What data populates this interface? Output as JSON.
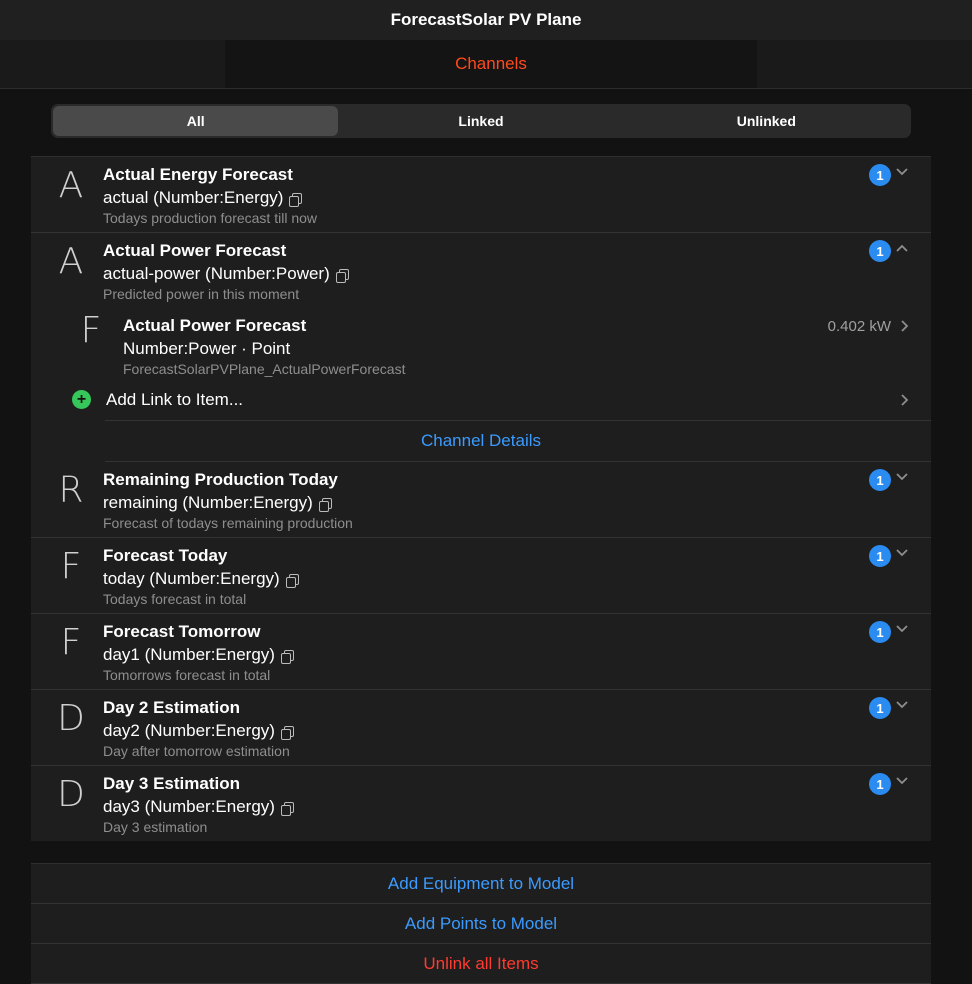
{
  "header": {
    "title": "ForecastSolar PV Plane"
  },
  "tabs": {
    "active_label": "Channels"
  },
  "filter": {
    "options": [
      "All",
      "Linked",
      "Unlinked"
    ],
    "selected": "All"
  },
  "channels": [
    {
      "letter": "A",
      "name": "Actual Energy Forecast",
      "id_type": "actual (Number:Energy)",
      "description": "Todays production forecast till now",
      "badge": "1",
      "expanded": false
    },
    {
      "letter": "A",
      "name": "Actual Power Forecast",
      "id_type": "actual-power (Number:Power)",
      "description": "Predicted power in this moment",
      "badge": "1",
      "expanded": true
    },
    {
      "letter": "R",
      "name": "Remaining Production Today",
      "id_type": "remaining (Number:Energy)",
      "description": "Forecast of todays remaining production",
      "badge": "1",
      "expanded": false
    },
    {
      "letter": "F",
      "name": "Forecast Today",
      "id_type": "today (Number:Energy)",
      "description": "Todays forecast in total",
      "badge": "1",
      "expanded": false
    },
    {
      "letter": "F",
      "name": "Forecast Tomorrow",
      "id_type": "day1 (Number:Energy)",
      "description": "Tomorrows forecast in total",
      "badge": "1",
      "expanded": false
    },
    {
      "letter": "D",
      "name": "Day 2 Estimation",
      "id_type": "day2 (Number:Energy)",
      "description": "Day after tomorrow estimation",
      "badge": "1",
      "expanded": false
    },
    {
      "letter": "D",
      "name": "Day 3 Estimation",
      "id_type": "day3 (Number:Energy)",
      "description": "Day 3 estimation",
      "badge": "1",
      "expanded": false
    }
  ],
  "linked_item": {
    "letter": "F",
    "name": "Actual Power Forecast",
    "type_line": "Number:Power · Point",
    "item_name": "ForecastSolarPVPlane_ActualPowerForecast",
    "state": "0.402 kW"
  },
  "add_link_label": "Add Link to Item...",
  "channel_details_label": "Channel Details",
  "actions": {
    "add_equipment": "Add Equipment to Model",
    "add_points": "Add Points to Model",
    "unlink_all": "Unlink all Items"
  },
  "colors": {
    "accent_tab": "#ff4a1c",
    "link_blue": "#3b9bff",
    "badge_blue": "#2a8cf0",
    "add_green": "#35c759",
    "danger_red": "#ff3b30"
  }
}
